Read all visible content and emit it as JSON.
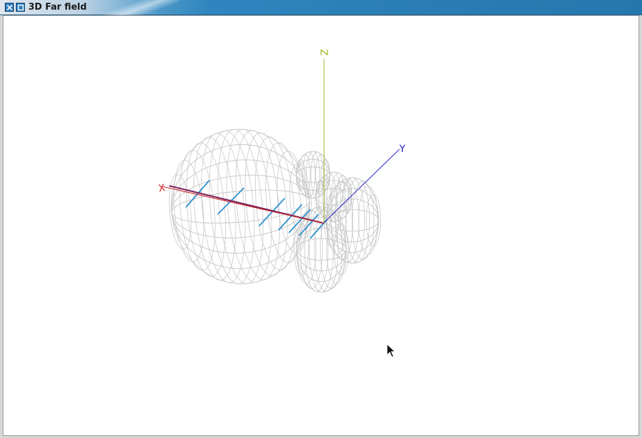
{
  "window": {
    "title": "3D Far field",
    "buttons": {
      "close_icon": "close-icon",
      "maximize_icon": "maximize-icon"
    }
  },
  "viewport": {
    "background": "#ffffff",
    "axes": {
      "x": {
        "label": "X",
        "color": "#cc2020"
      },
      "y": {
        "label": "Y",
        "color": "#2020cc"
      },
      "z": {
        "label": "Z",
        "color": "#9ab820"
      }
    },
    "pattern_mesh_color": "#c8c8c8",
    "antenna_elements_color": "#2a8fd0",
    "boom_color": "#7a1f5a"
  }
}
